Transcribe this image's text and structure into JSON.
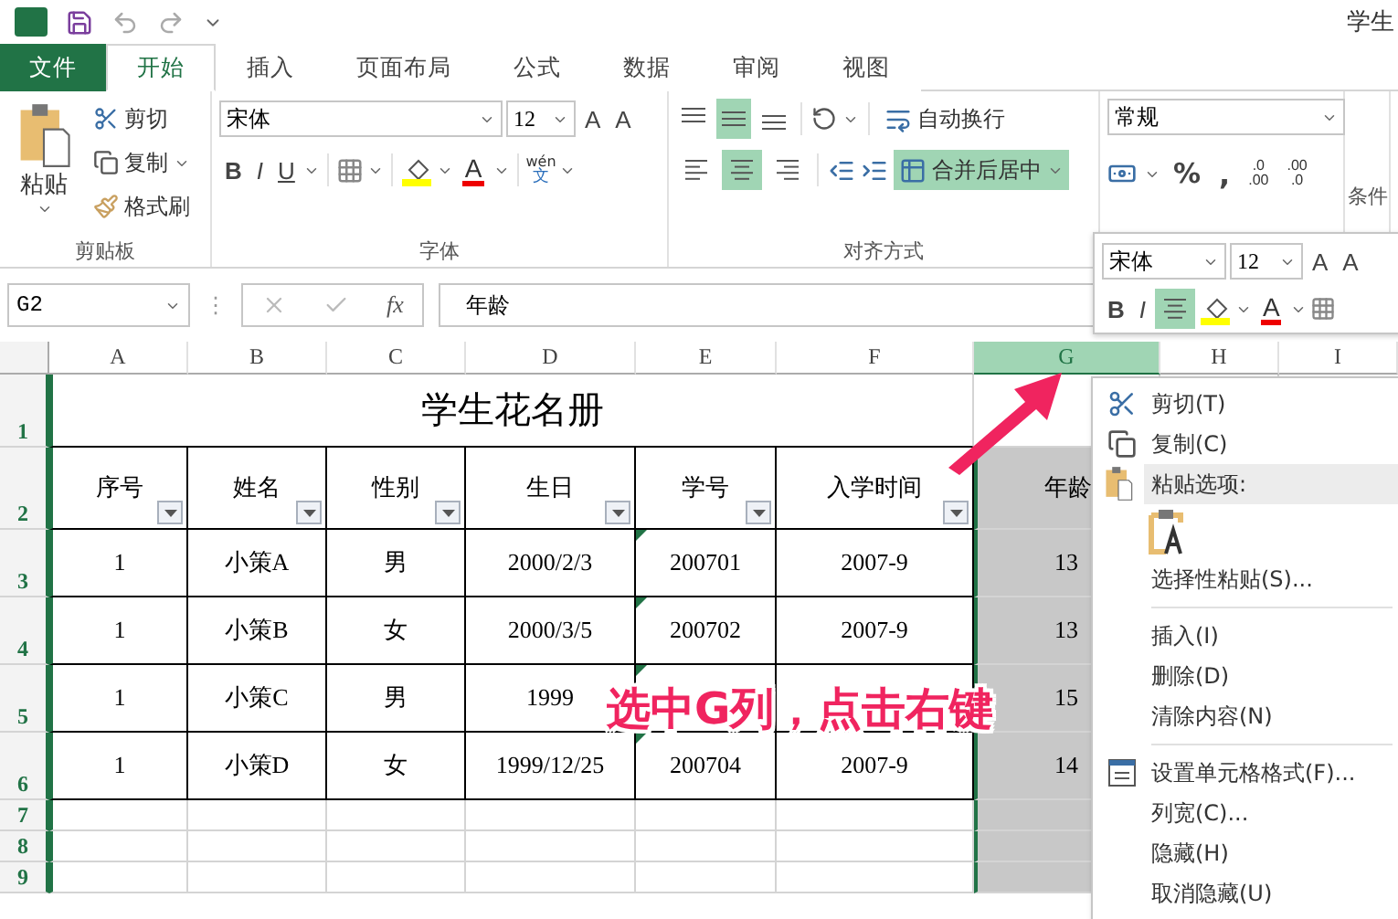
{
  "title_bar": {
    "title": "学生"
  },
  "tabs": [
    {
      "label": "文件",
      "kind": "file",
      "selected": false
    },
    {
      "label": "开始",
      "kind": "tab",
      "selected": true
    },
    {
      "label": "插入",
      "kind": "tab",
      "selected": false
    },
    {
      "label": "页面布局",
      "kind": "tab",
      "selected": false
    },
    {
      "label": "公式",
      "kind": "tab",
      "selected": false
    },
    {
      "label": "数据",
      "kind": "tab",
      "selected": false
    },
    {
      "label": "审阅",
      "kind": "tab",
      "selected": false
    },
    {
      "label": "视图",
      "kind": "tab",
      "selected": false
    }
  ],
  "clipboard": {
    "paste": "粘贴",
    "cut": "剪切",
    "copy": "复制",
    "format_painter": "格式刷",
    "group_label": "剪贴板"
  },
  "font": {
    "name": "宋体",
    "size": "12",
    "grow": "A",
    "shrink": "A",
    "bold": "B",
    "italic": "I",
    "underline": "U",
    "font_color": "A",
    "phonetic_top": "wén",
    "phonetic_bottom": "文",
    "group_label": "字体"
  },
  "alignment": {
    "vertical": [
      {
        "kind": "top",
        "selected": false
      },
      {
        "kind": "middle",
        "selected": true
      },
      {
        "kind": "bottom",
        "selected": false
      }
    ],
    "horizontal": [
      {
        "kind": "left",
        "selected": false
      },
      {
        "kind": "center",
        "selected": true
      },
      {
        "kind": "right",
        "selected": false
      }
    ],
    "wrap_text": {
      "label": "自动换行",
      "selected": false
    },
    "merge_center": {
      "label": "合并后居中",
      "selected": true
    },
    "group_label": "对齐方式"
  },
  "number": {
    "format": "常规",
    "percent": "%",
    "comma": ",",
    "add_decimal": [
      ".0",
      ".00"
    ],
    "remove_decimal": [
      ".00",
      ".0"
    ]
  },
  "next_group_label": "条件",
  "formula_bar": {
    "name_box": "G2",
    "grip": "⋮",
    "fx": "fx",
    "formula": "年龄"
  },
  "columns": [
    {
      "label": "A",
      "selected": false
    },
    {
      "label": "B",
      "selected": false
    },
    {
      "label": "C",
      "selected": false
    },
    {
      "label": "D",
      "selected": false
    },
    {
      "label": "E",
      "selected": false
    },
    {
      "label": "F",
      "selected": false
    },
    {
      "label": "G",
      "selected": true
    },
    {
      "label": "H",
      "selected": false
    },
    {
      "label": "I",
      "selected": false
    }
  ],
  "rows": [
    "1",
    "2",
    "3",
    "4",
    "5",
    "6",
    "7",
    "8",
    "9"
  ],
  "sheet": {
    "title": "学生花名册",
    "headers": [
      {
        "label": "序号",
        "filter": true
      },
      {
        "label": "姓名",
        "filter": true
      },
      {
        "label": "性别",
        "filter": true
      },
      {
        "label": "生日",
        "filter": true
      },
      {
        "label": "学号",
        "filter": true
      },
      {
        "label": "入学时间",
        "filter": true
      },
      {
        "label": "年龄",
        "filter": false
      }
    ],
    "records": [
      {
        "no": "1",
        "name": "小策A",
        "gender": "男",
        "birthday": "2000/2/3",
        "student_id": "200701",
        "flagged": true,
        "enrolled": "2007-9",
        "age": "13"
      },
      {
        "no": "1",
        "name": "小策B",
        "gender": "女",
        "birthday": "2000/3/5",
        "student_id": "200702",
        "flagged": true,
        "enrolled": "2007-9",
        "age": "13"
      },
      {
        "no": "1",
        "name": "小策C",
        "gender": "男",
        "birthday": "1999",
        "flagged": true,
        "age": "15"
      },
      {
        "no": "1",
        "name": "小策D",
        "gender": "女",
        "birthday": "1999/12/25",
        "student_id": "200704",
        "flagged": true,
        "enrolled": "2007-9",
        "age": "14"
      }
    ]
  },
  "mini_toolbar": {
    "font": "宋体",
    "size": "12",
    "grow": "A",
    "shrink": "A",
    "bold": "B",
    "italic": "I",
    "font_color": "A"
  },
  "context_menu": [
    {
      "kind": "cut",
      "label": "剪切(T)"
    },
    {
      "kind": "copy",
      "label": "复制(C)"
    },
    {
      "kind": "heading",
      "label": "粘贴选项:"
    },
    {
      "kind": "paste_options"
    },
    {
      "kind": "item",
      "label": "选择性粘贴(S)..."
    },
    {
      "kind": "separator"
    },
    {
      "kind": "item",
      "label": "插入(I)"
    },
    {
      "kind": "item",
      "label": "删除(D)"
    },
    {
      "kind": "item",
      "label": "清除内容(N)"
    },
    {
      "kind": "separator"
    },
    {
      "kind": "format",
      "label": "设置单元格格式(F)..."
    },
    {
      "kind": "item",
      "label": "列宽(C)..."
    },
    {
      "kind": "item",
      "label": "隐藏(H)"
    },
    {
      "kind": "item",
      "label": "取消隐藏(U)"
    }
  ],
  "annotation": {
    "text": "选中G列，点击右键"
  }
}
